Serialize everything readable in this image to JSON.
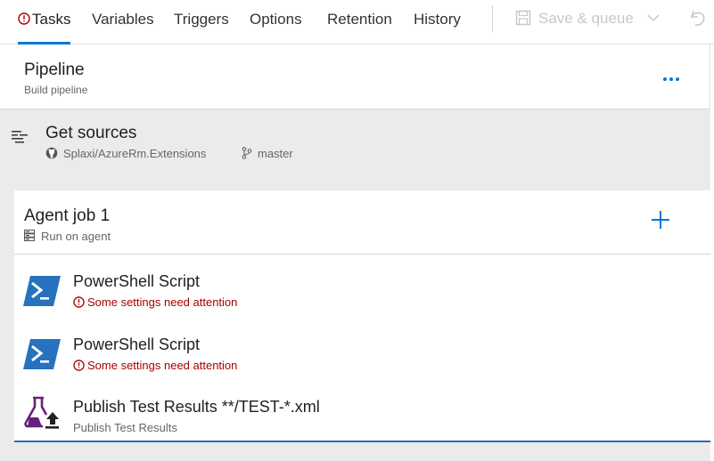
{
  "tabs": [
    {
      "label": "Tasks",
      "active": true,
      "warning": true
    },
    {
      "label": "Variables"
    },
    {
      "label": "Triggers"
    },
    {
      "label": "Options"
    },
    {
      "label": "Retention"
    },
    {
      "label": "History"
    }
  ],
  "toolbar": {
    "save_queue_label": "Save & queue",
    "save_icon": "save-icon",
    "undo_icon": "undo-icon"
  },
  "pipeline": {
    "title": "Pipeline",
    "subtitle": "Build pipeline"
  },
  "sources": {
    "title": "Get sources",
    "repo": "Splaxi/AzureRm.Extensions",
    "branch": "master"
  },
  "job": {
    "title": "Agent job 1",
    "subtitle": "Run on agent"
  },
  "tasks": [
    {
      "title": "PowerShell Script",
      "warning": "Some settings need attention",
      "icon": "powershell-icon"
    },
    {
      "title": "PowerShell Script",
      "warning": "Some settings need attention",
      "icon": "powershell-icon"
    },
    {
      "title": "Publish Test Results **/TEST-*.xml",
      "subtitle": "Publish Test Results",
      "icon": "publish-test-results-icon"
    }
  ],
  "colors": {
    "accent": "#0078d4",
    "error": "#a80000",
    "powershell": "#2672be",
    "flask": "#68217a"
  }
}
